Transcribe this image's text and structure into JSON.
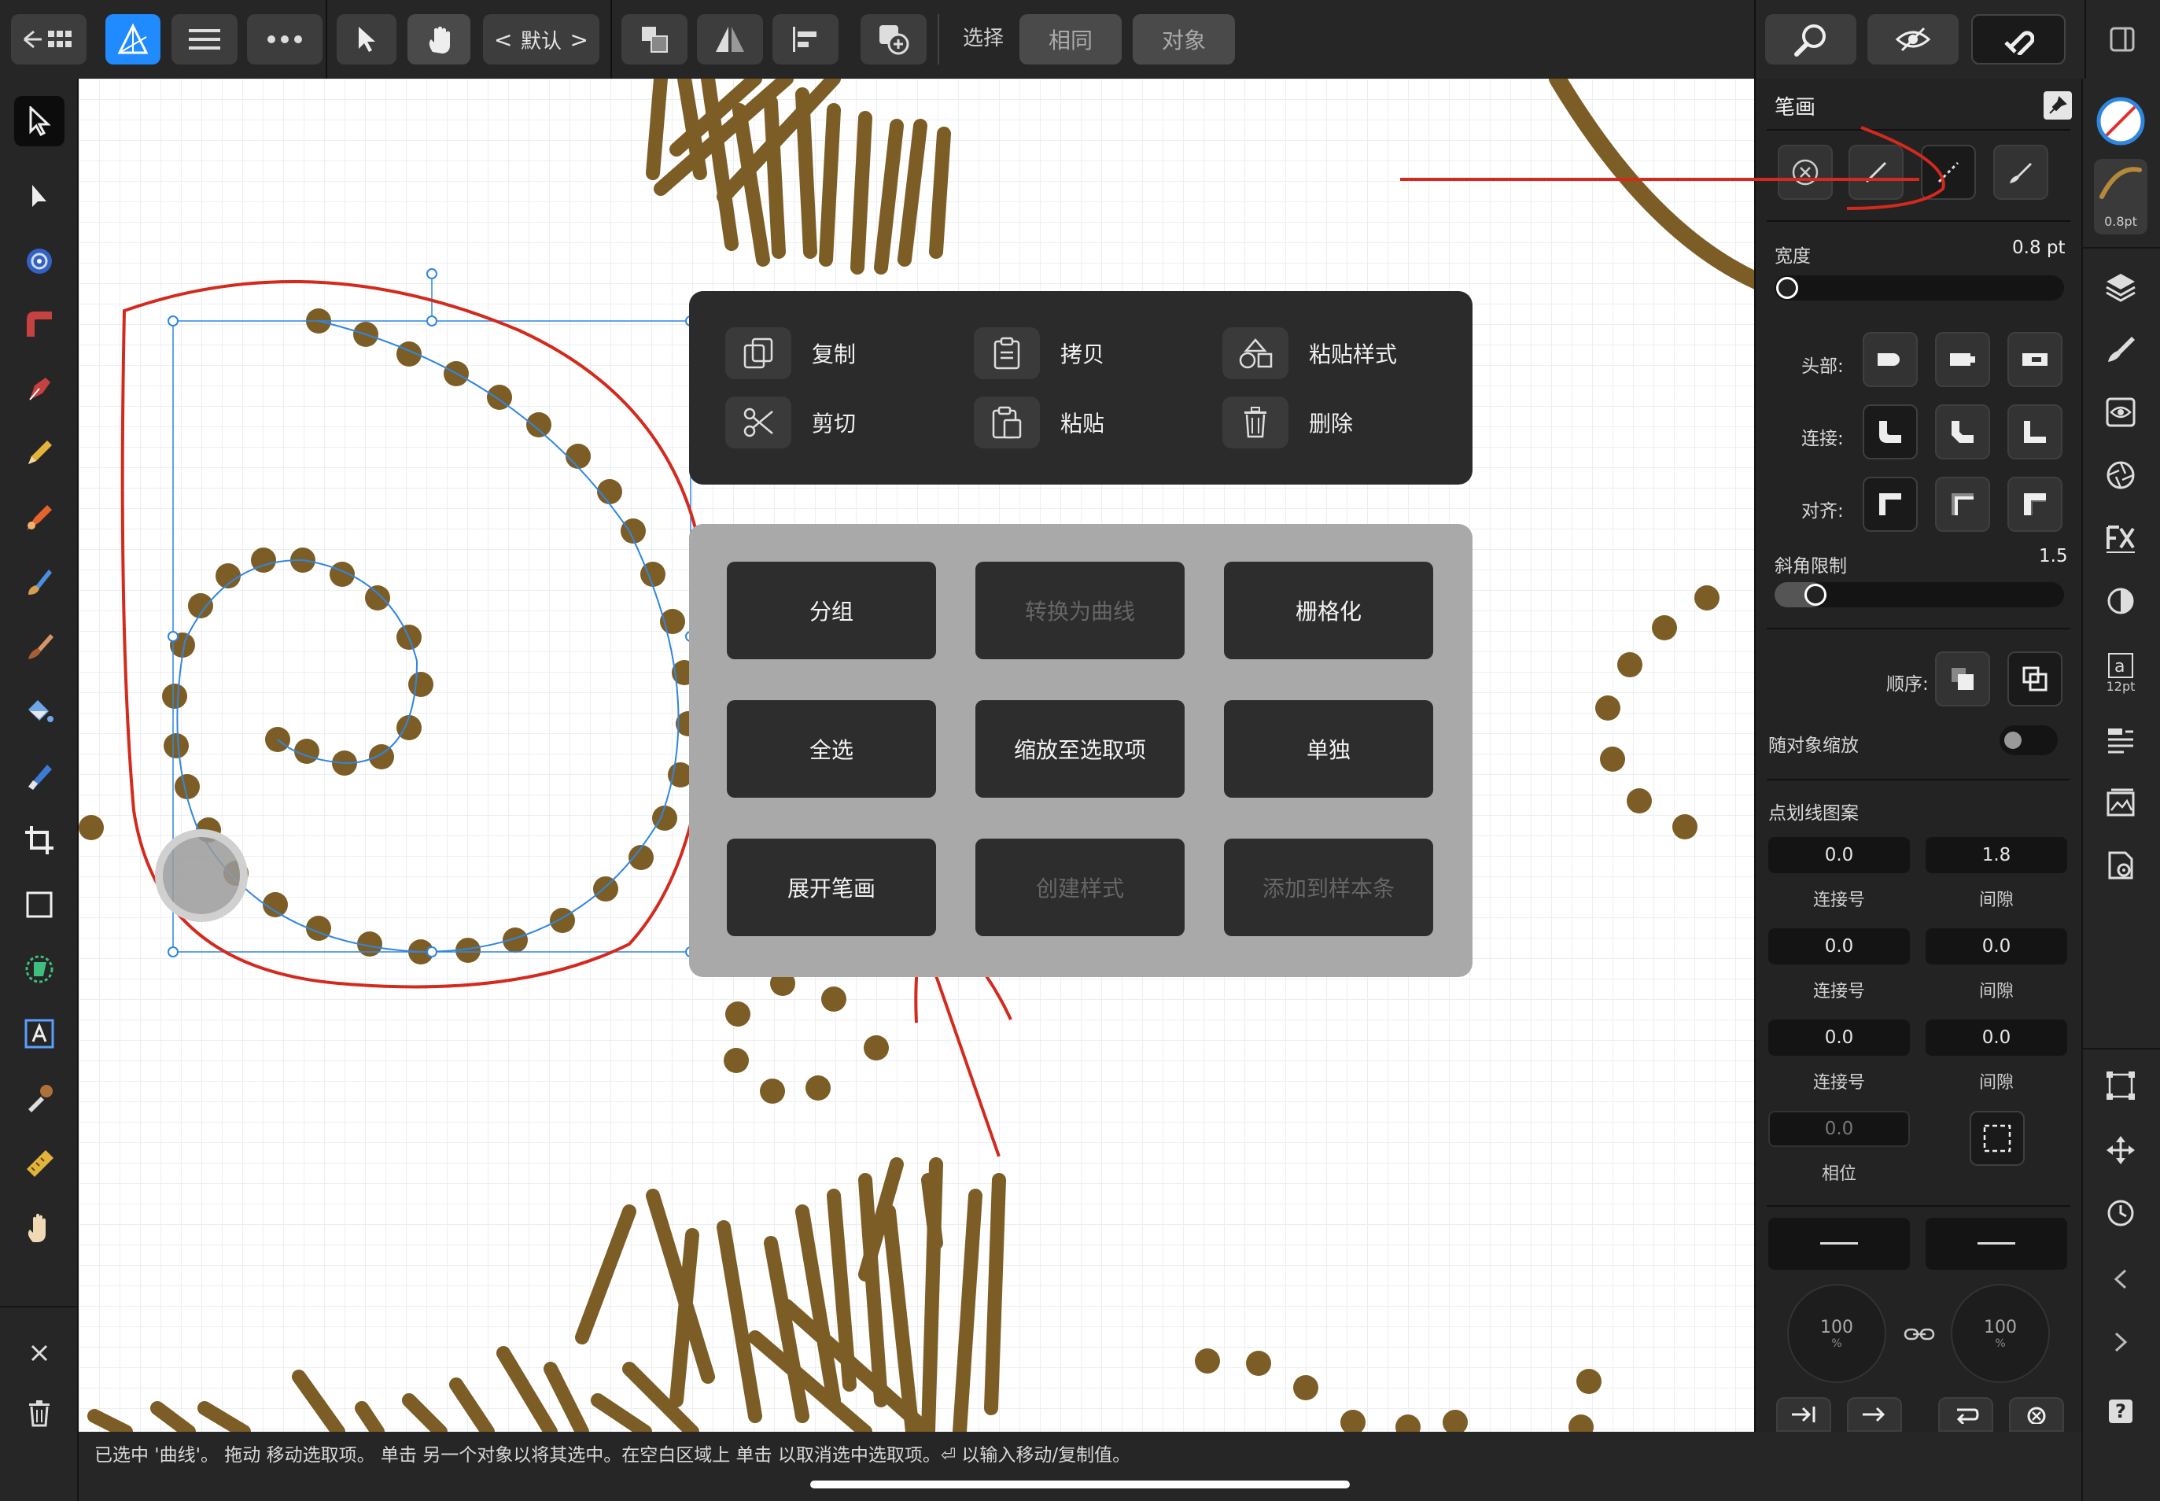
{
  "toolbar": {
    "default_label": "默认",
    "select_label": "选择",
    "same_button": "相同",
    "object_button": "对象"
  },
  "stroke_panel": {
    "title": "笔画",
    "width_label": "宽度",
    "width_value": "0.8 pt",
    "cap_label": "头部:",
    "join_label": "连接:",
    "align_label": "对齐:",
    "miter_label": "斜角限制",
    "miter_value": "1.5",
    "order_label": "顺序:",
    "scale_label": "随对象缩放",
    "dash_title": "点划线图案",
    "dash_fields": [
      {
        "dash": "0.0",
        "gap": "1.8",
        "dash_label": "连接号",
        "gap_label": "间隙"
      },
      {
        "dash": "0.0",
        "gap": "0.0",
        "dash_label": "连接号",
        "gap_label": "间隙"
      },
      {
        "dash": "0.0",
        "gap": "0.0",
        "dash_label": "连接号",
        "gap_label": "间隙"
      }
    ],
    "phase_value": "0.0",
    "phase_label": "相位",
    "start_pct": "100",
    "end_pct": "100",
    "pct_unit": "%"
  },
  "right_tools": {
    "stroke_size": "0.8pt",
    "text_size": "12pt"
  },
  "context_menu": {
    "copy": "复制",
    "duplicate": "拷贝",
    "paste_style": "粘贴样式",
    "cut": "剪切",
    "paste": "粘贴",
    "delete": "删除"
  },
  "action_grid": {
    "group": "分组",
    "convert_to_curves": "转换为曲线",
    "rasterize": "栅格化",
    "select_all": "全选",
    "zoom_to_selection": "缩放至选取项",
    "isolate": "单独",
    "expand_stroke": "展开笔画",
    "create_style": "创建样式",
    "add_to_swatches": "添加到样本条"
  },
  "status_bar": {
    "text": "已选中 '曲线'。 拖动 移动选取项。 单击 另一个对象以将其选中。在空白区域上 单击 以取消选中选取项。⏎ 以输入移动/复制值。"
  },
  "colors": {
    "accent": "#1f8bff",
    "brown": "#7d5d26",
    "annotation_red": "#d42a1e"
  }
}
